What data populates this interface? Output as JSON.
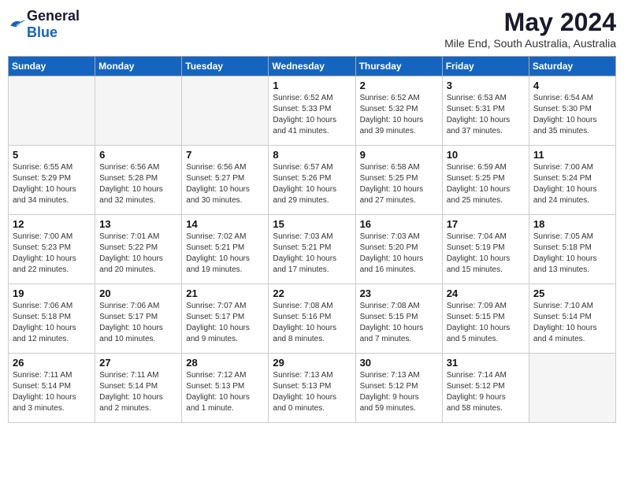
{
  "logo": {
    "general": "General",
    "blue": "Blue"
  },
  "header": {
    "month": "May 2024",
    "location": "Mile End, South Australia, Australia"
  },
  "weekdays": [
    "Sunday",
    "Monday",
    "Tuesday",
    "Wednesday",
    "Thursday",
    "Friday",
    "Saturday"
  ],
  "weeks": [
    [
      {
        "day": "",
        "info": ""
      },
      {
        "day": "",
        "info": ""
      },
      {
        "day": "",
        "info": ""
      },
      {
        "day": "1",
        "info": "Sunrise: 6:52 AM\nSunset: 5:33 PM\nDaylight: 10 hours\nand 41 minutes."
      },
      {
        "day": "2",
        "info": "Sunrise: 6:52 AM\nSunset: 5:32 PM\nDaylight: 10 hours\nand 39 minutes."
      },
      {
        "day": "3",
        "info": "Sunrise: 6:53 AM\nSunset: 5:31 PM\nDaylight: 10 hours\nand 37 minutes."
      },
      {
        "day": "4",
        "info": "Sunrise: 6:54 AM\nSunset: 5:30 PM\nDaylight: 10 hours\nand 35 minutes."
      }
    ],
    [
      {
        "day": "5",
        "info": "Sunrise: 6:55 AM\nSunset: 5:29 PM\nDaylight: 10 hours\nand 34 minutes."
      },
      {
        "day": "6",
        "info": "Sunrise: 6:56 AM\nSunset: 5:28 PM\nDaylight: 10 hours\nand 32 minutes."
      },
      {
        "day": "7",
        "info": "Sunrise: 6:56 AM\nSunset: 5:27 PM\nDaylight: 10 hours\nand 30 minutes."
      },
      {
        "day": "8",
        "info": "Sunrise: 6:57 AM\nSunset: 5:26 PM\nDaylight: 10 hours\nand 29 minutes."
      },
      {
        "day": "9",
        "info": "Sunrise: 6:58 AM\nSunset: 5:25 PM\nDaylight: 10 hours\nand 27 minutes."
      },
      {
        "day": "10",
        "info": "Sunrise: 6:59 AM\nSunset: 5:25 PM\nDaylight: 10 hours\nand 25 minutes."
      },
      {
        "day": "11",
        "info": "Sunrise: 7:00 AM\nSunset: 5:24 PM\nDaylight: 10 hours\nand 24 minutes."
      }
    ],
    [
      {
        "day": "12",
        "info": "Sunrise: 7:00 AM\nSunset: 5:23 PM\nDaylight: 10 hours\nand 22 minutes."
      },
      {
        "day": "13",
        "info": "Sunrise: 7:01 AM\nSunset: 5:22 PM\nDaylight: 10 hours\nand 20 minutes."
      },
      {
        "day": "14",
        "info": "Sunrise: 7:02 AM\nSunset: 5:21 PM\nDaylight: 10 hours\nand 19 minutes."
      },
      {
        "day": "15",
        "info": "Sunrise: 7:03 AM\nSunset: 5:21 PM\nDaylight: 10 hours\nand 17 minutes."
      },
      {
        "day": "16",
        "info": "Sunrise: 7:03 AM\nSunset: 5:20 PM\nDaylight: 10 hours\nand 16 minutes."
      },
      {
        "day": "17",
        "info": "Sunrise: 7:04 AM\nSunset: 5:19 PM\nDaylight: 10 hours\nand 15 minutes."
      },
      {
        "day": "18",
        "info": "Sunrise: 7:05 AM\nSunset: 5:18 PM\nDaylight: 10 hours\nand 13 minutes."
      }
    ],
    [
      {
        "day": "19",
        "info": "Sunrise: 7:06 AM\nSunset: 5:18 PM\nDaylight: 10 hours\nand 12 minutes."
      },
      {
        "day": "20",
        "info": "Sunrise: 7:06 AM\nSunset: 5:17 PM\nDaylight: 10 hours\nand 10 minutes."
      },
      {
        "day": "21",
        "info": "Sunrise: 7:07 AM\nSunset: 5:17 PM\nDaylight: 10 hours\nand 9 minutes."
      },
      {
        "day": "22",
        "info": "Sunrise: 7:08 AM\nSunset: 5:16 PM\nDaylight: 10 hours\nand 8 minutes."
      },
      {
        "day": "23",
        "info": "Sunrise: 7:08 AM\nSunset: 5:15 PM\nDaylight: 10 hours\nand 7 minutes."
      },
      {
        "day": "24",
        "info": "Sunrise: 7:09 AM\nSunset: 5:15 PM\nDaylight: 10 hours\nand 5 minutes."
      },
      {
        "day": "25",
        "info": "Sunrise: 7:10 AM\nSunset: 5:14 PM\nDaylight: 10 hours\nand 4 minutes."
      }
    ],
    [
      {
        "day": "26",
        "info": "Sunrise: 7:11 AM\nSunset: 5:14 PM\nDaylight: 10 hours\nand 3 minutes."
      },
      {
        "day": "27",
        "info": "Sunrise: 7:11 AM\nSunset: 5:14 PM\nDaylight: 10 hours\nand 2 minutes."
      },
      {
        "day": "28",
        "info": "Sunrise: 7:12 AM\nSunset: 5:13 PM\nDaylight: 10 hours\nand 1 minute."
      },
      {
        "day": "29",
        "info": "Sunrise: 7:13 AM\nSunset: 5:13 PM\nDaylight: 10 hours\nand 0 minutes."
      },
      {
        "day": "30",
        "info": "Sunrise: 7:13 AM\nSunset: 5:12 PM\nDaylight: 9 hours\nand 59 minutes."
      },
      {
        "day": "31",
        "info": "Sunrise: 7:14 AM\nSunset: 5:12 PM\nDaylight: 9 hours\nand 58 minutes."
      },
      {
        "day": "",
        "info": ""
      }
    ]
  ]
}
